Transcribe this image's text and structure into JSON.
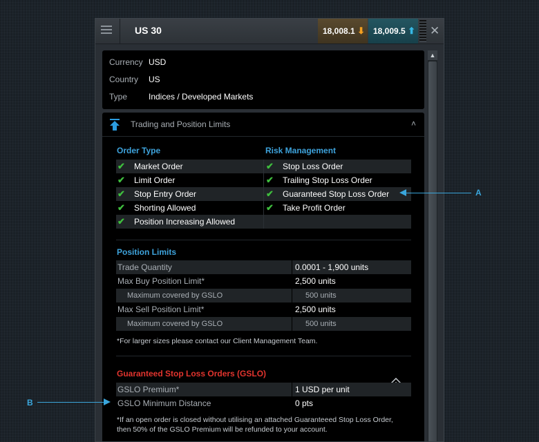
{
  "window": {
    "title": "US 30",
    "sell_price": "18,008.1",
    "buy_price": "18,009.5",
    "close_glyph": "✕",
    "icons": {
      "menu": "hamburger-menu-icon",
      "sell": "arrow-down-icon",
      "buy": "arrow-up-icon",
      "close": "close-icon"
    }
  },
  "info": {
    "rows": [
      {
        "label": "Currency",
        "value": "USD"
      },
      {
        "label": "Country",
        "value": "US"
      },
      {
        "label": "Type",
        "value": "Indices / Developed Markets"
      }
    ]
  },
  "trading": {
    "header": "Trading and Position Limits",
    "order_type": {
      "title": "Order Type",
      "items": [
        "Market Order",
        "Limit Order",
        "Stop Entry Order",
        "Shorting Allowed",
        "Position Increasing Allowed"
      ]
    },
    "risk_management": {
      "title": "Risk Management",
      "items": [
        "Stop Loss Order",
        "Trailing Stop Loss Order",
        "Guaranteed Stop Loss Order",
        "Take Profit Order"
      ]
    },
    "position_limits": {
      "title": "Position Limits",
      "rows": [
        {
          "label": "Trade Quantity",
          "value": "0.0001 - 1,900 units",
          "sub": false
        },
        {
          "label": "Max Buy Position Limit*",
          "value": "2,500 units",
          "sub": false
        },
        {
          "label": "Maximum covered by GSLO",
          "value": "500 units",
          "sub": true
        },
        {
          "label": "Max Sell Position Limit*",
          "value": "2,500 units",
          "sub": false
        },
        {
          "label": "Maximum covered by GSLO",
          "value": "500 units",
          "sub": true
        }
      ],
      "note": "*For larger sizes please contact our Client Management Team."
    },
    "gslo": {
      "title": "Guaranteed Stop Loss Orders (GSLO)",
      "rows": [
        {
          "label": "GSLO Premium*",
          "value": "1 USD per unit"
        },
        {
          "label": "GSLO Minimum Distance",
          "value": "0 pts"
        }
      ],
      "note_line1": "*If an open order is closed without utilising an attached Guaranteeed Stop Loss Order,",
      "note_line2": "then 50% of the GSLO Premium will be refunded to your account."
    }
  },
  "callouts": {
    "a": "A",
    "b": "B"
  },
  "colors": {
    "accent_blue": "#3ea3dc",
    "gslo_red": "#e2342e",
    "check_green": "#3fbe3e",
    "sell_orange": "#f3a020"
  }
}
